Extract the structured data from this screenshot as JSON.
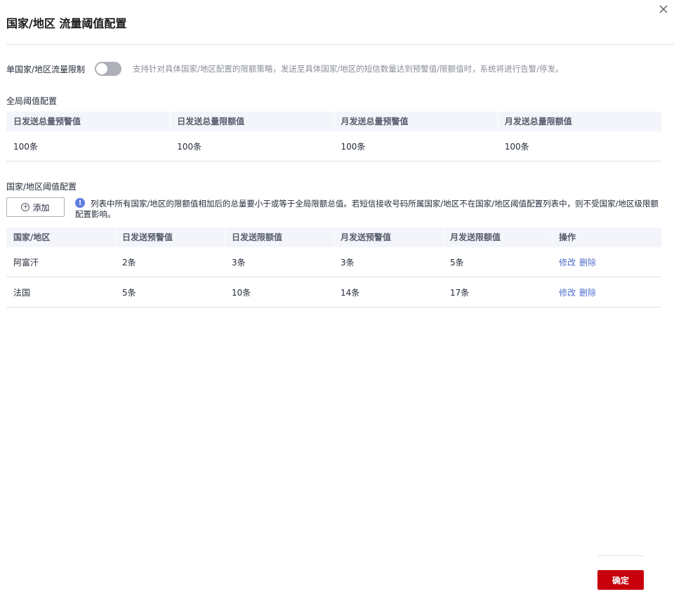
{
  "dialog": {
    "title": "国家/地区 流量阈值配置",
    "close_icon": "close-icon"
  },
  "limit": {
    "label": "单国家/地区流量限制",
    "toggle_on": false,
    "description": "支持针对具体国家/地区配置的限额策略，发送至具体国家/地区的短信数量达到预警值/限额值时，系统将进行告警/停发。"
  },
  "global": {
    "section_title": "全局阈值配置",
    "headers": [
      "日发送总量预警值",
      "日发送总量限额值",
      "月发送总量预警值",
      "月发送总量限额值"
    ],
    "values": [
      "100条",
      "100条",
      "100条",
      "100条"
    ]
  },
  "country": {
    "section_title": "国家/地区阈值配置",
    "add_label": "添加",
    "info_icon": "info-icon",
    "info_text": "列表中所有国家/地区的限额值相加后的总量要小于或等于全局限额总值。若短信接收号码所属国家/地区不在国家/地区阈值配置列表中，则不受国家/地区级限额配置影响。",
    "headers": [
      "国家/地区",
      "日发送预警值",
      "日发送限额值",
      "月发送预警值",
      "月发送限额值",
      "操作"
    ],
    "rows": [
      {
        "name": "阿富汗",
        "day_warn": "2条",
        "day_limit": "3条",
        "month_warn": "3条",
        "month_limit": "5条",
        "edit": "修改",
        "delete": "删除"
      },
      {
        "name": "法国",
        "day_warn": "5条",
        "day_limit": "10条",
        "month_warn": "14条",
        "month_limit": "17条",
        "edit": "修改",
        "delete": "删除"
      }
    ]
  },
  "footer": {
    "confirm_label": "确定"
  },
  "colors": {
    "primary_button": "#c7000b",
    "link": "#526ecc",
    "info": "#5e7ce0",
    "toggle_off": "#adb0b8"
  }
}
